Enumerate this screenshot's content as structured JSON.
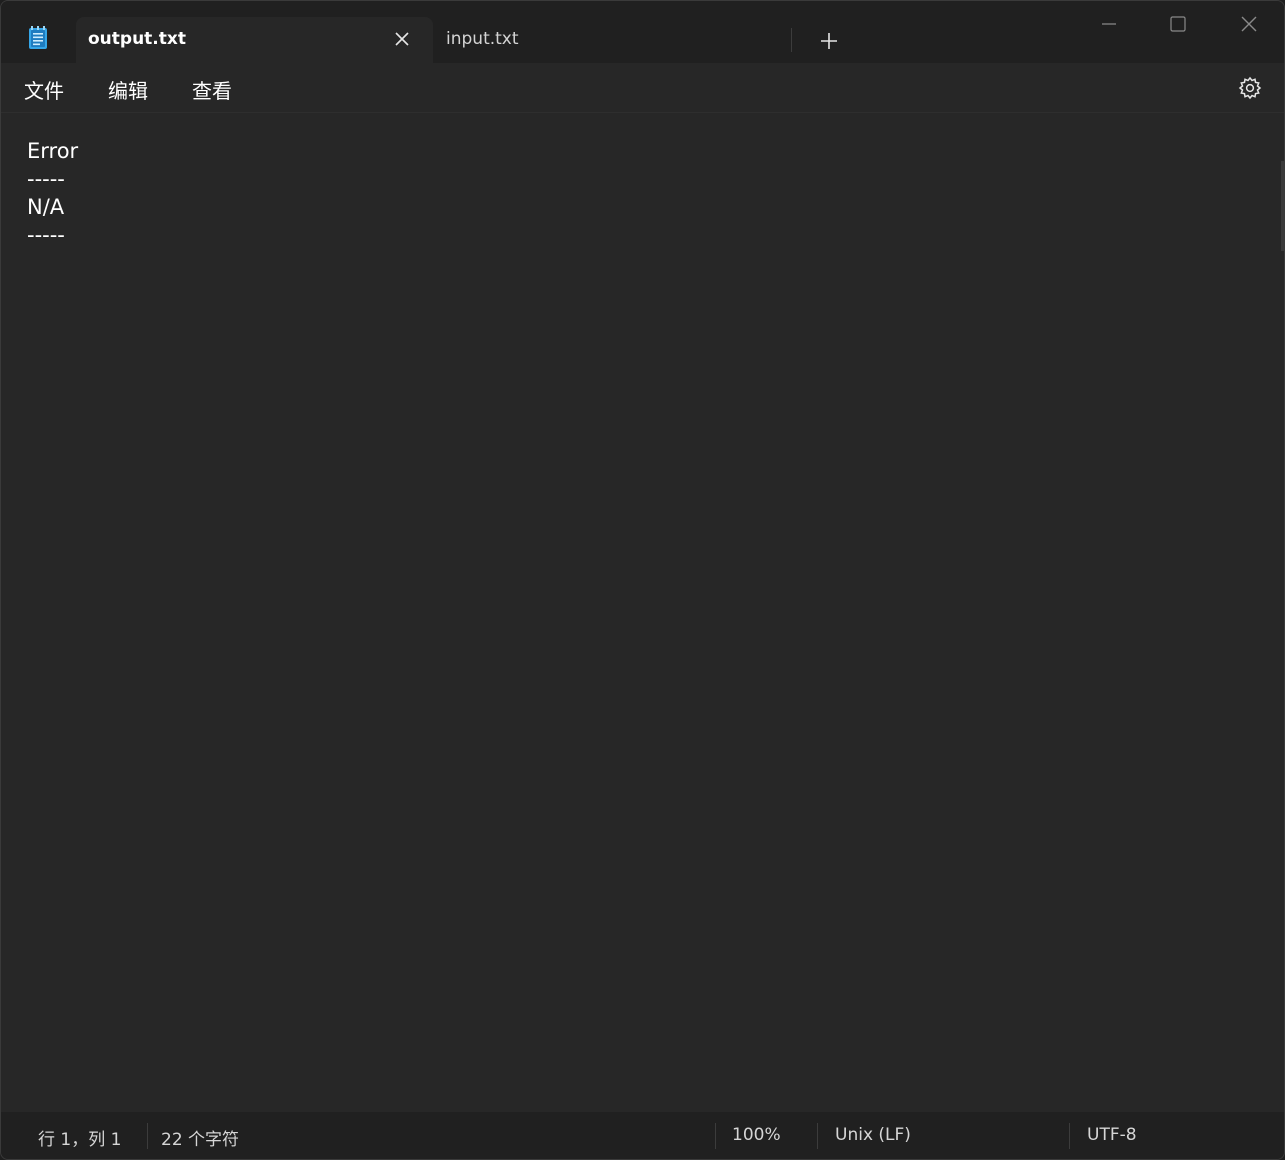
{
  "tabs": [
    {
      "label": "output.txt",
      "active": true
    },
    {
      "label": "input.txt",
      "active": false
    }
  ],
  "menu": {
    "file": "文件",
    "edit": "编辑",
    "view": "查看"
  },
  "editor": {
    "content": "Error\n-----\nN/A\n-----"
  },
  "status": {
    "position": "行 1，列 1",
    "chars": "22 个字符",
    "zoom": "100%",
    "line_ending": "Unix (LF)",
    "encoding": "UTF-8"
  },
  "icons": {
    "app": "notepad-icon",
    "close_tab": "close-icon",
    "new_tab": "plus-icon",
    "settings": "gear-icon"
  }
}
